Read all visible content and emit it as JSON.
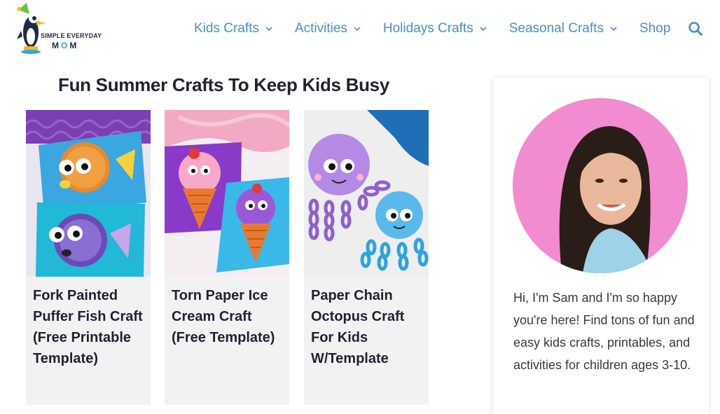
{
  "header": {
    "logo": {
      "line1": "SIMPLE EVERYDAY",
      "line2_part1": "M",
      "line2_part2": "O",
      "line2_part3": "M"
    },
    "nav": [
      {
        "label": "Kids Crafts",
        "has_dropdown": true
      },
      {
        "label": "Activities",
        "has_dropdown": true
      },
      {
        "label": "Holidays Crafts",
        "has_dropdown": true
      },
      {
        "label": "Seasonal Crafts",
        "has_dropdown": true
      },
      {
        "label": "Shop",
        "has_dropdown": false
      }
    ],
    "search_icon": "search-icon"
  },
  "main": {
    "section_title": "Fun Summer Crafts To Keep Kids Busy",
    "cards": [
      {
        "title": "Fork Painted Puffer Fish Craft (Free Printable Template)"
      },
      {
        "title": "Torn Paper Ice Cream Craft (Free Template)"
      },
      {
        "title": "Paper Chain Octopus Craft For Kids W/Template"
      }
    ]
  },
  "sidebar": {
    "bio": "Hi, I'm Sam and I'm so happy you're here! Find tons of fun and easy kids crafts, printables, and activities for children ages 3-10."
  },
  "colors": {
    "nav": "#4a8fc7",
    "title": "#1f2330",
    "card_bg": "#f2f2f2",
    "avatar_bg": "#f08ccf"
  }
}
